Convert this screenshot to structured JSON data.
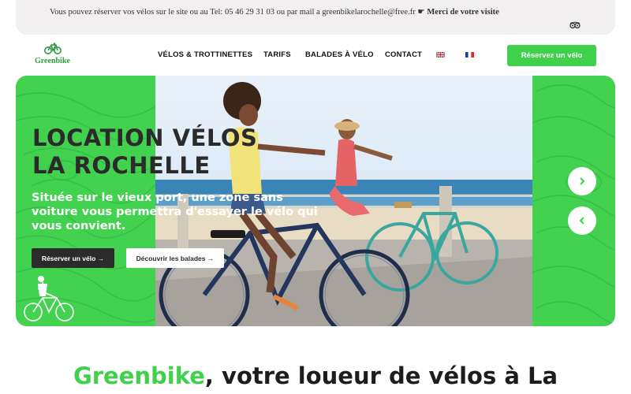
{
  "topbar": {
    "info_text": "Vous pouvez réserver vos vélos sur le site ou au Tel:  05 46 29 31 03 ou par mail a greenbikelarochelle@free.fr ",
    "hand_symbol": "☛",
    "thanks": "Merci de votre visite",
    "tripadvisor_icon": "owl-icon"
  },
  "header": {
    "logo_text": "Greenbike",
    "nav": [
      "VÉLOS & TROTTINETTES",
      "TARIFS",
      "BALADES À VÉLO",
      "CONTACT"
    ],
    "flags": [
      "uk-flag-icon",
      "france-flag-icon"
    ],
    "cta_label": "Réservez un vélo"
  },
  "hero": {
    "title_line1": "LOCATION  VÉLOS",
    "title_line2": "LA ROCHELLE",
    "subtitle": "Située sur le vieux port, une zone sans voiture vous permettra d'essayer le vélo qui vous convient.",
    "btn_reserve": "Réserver un vélo →",
    "btn_discover": "Découvrir les balades →",
    "next_icon": "chevron-right-icon",
    "prev_icon": "chevron-left-icon"
  },
  "headline": {
    "brand": "Greenbike",
    "rest": ", votre loueur de vélos à La"
  },
  "colors": {
    "green": "#3fd14b",
    "dark": "#2b2b2b",
    "topbar_bg": "#f1efef"
  }
}
